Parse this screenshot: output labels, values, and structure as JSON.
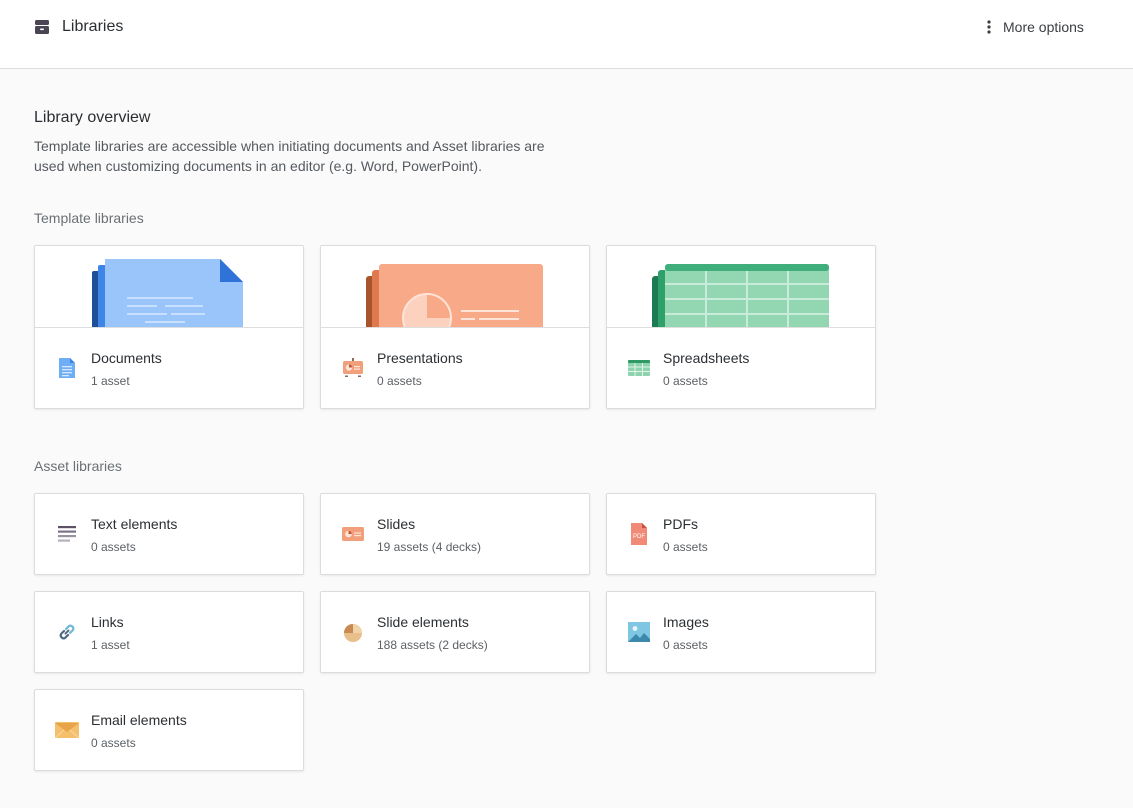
{
  "header": {
    "title": "Libraries",
    "more_options_label": "More options"
  },
  "overview": {
    "title": "Library overview",
    "description": "Template libraries are accessible when initiating documents and Asset libraries are used when customizing documents in an editor (e.g. Word, PowerPoint)."
  },
  "template_section": {
    "title": "Template libraries",
    "cards": [
      {
        "name": "Documents",
        "count": "1 asset",
        "icon": "document-icon",
        "color": "#5a9ff0"
      },
      {
        "name": "Presentations",
        "count": "0 assets",
        "icon": "presentation-icon",
        "color": "#f2a07b"
      },
      {
        "name": "Spreadsheets",
        "count": "0 assets",
        "icon": "spreadsheet-icon",
        "color": "#3fae7a"
      }
    ]
  },
  "asset_section": {
    "title": "Asset libraries",
    "cards": [
      {
        "name": "Text elements",
        "count": "0 assets",
        "icon": "text-lines-icon"
      },
      {
        "name": "Slides",
        "count": "19 assets (4 decks)",
        "icon": "slide-icon"
      },
      {
        "name": "PDFs",
        "count": "0 assets",
        "icon": "pdf-icon"
      },
      {
        "name": "Links",
        "count": "1 asset",
        "icon": "link-icon"
      },
      {
        "name": "Slide elements",
        "count": "188 assets (2 decks)",
        "icon": "pie-chart-icon"
      },
      {
        "name": "Images",
        "count": "0 assets",
        "icon": "image-icon"
      },
      {
        "name": "Email elements",
        "count": "0 assets",
        "icon": "envelope-icon"
      }
    ]
  },
  "icons": {
    "pdf_label": "PDF"
  }
}
